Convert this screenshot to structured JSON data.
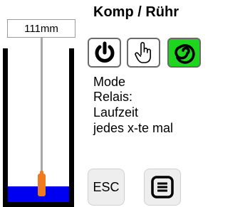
{
  "gauge": {
    "level_readout": "111mm",
    "fill_fraction": 0.1,
    "colors": {
      "water": "#0000f0",
      "float": "#f07a1e",
      "probe": "#a8a8a8"
    }
  },
  "header": {
    "title": "Komp / Rühr"
  },
  "mode_buttons": [
    {
      "icon": "power-icon",
      "active": false
    },
    {
      "icon": "hand-pointer-icon",
      "active": false
    },
    {
      "icon": "swirl-icon",
      "active": true,
      "color": "#1fd61f"
    }
  ],
  "info": {
    "mode_label": "Mode",
    "relais_label": "Relais:",
    "laufzeit_label": "Laufzeit",
    "jedes_label": "jedes x-te mal"
  },
  "footer": {
    "esc_label": "ESC",
    "menu_icon": "menu-icon"
  }
}
